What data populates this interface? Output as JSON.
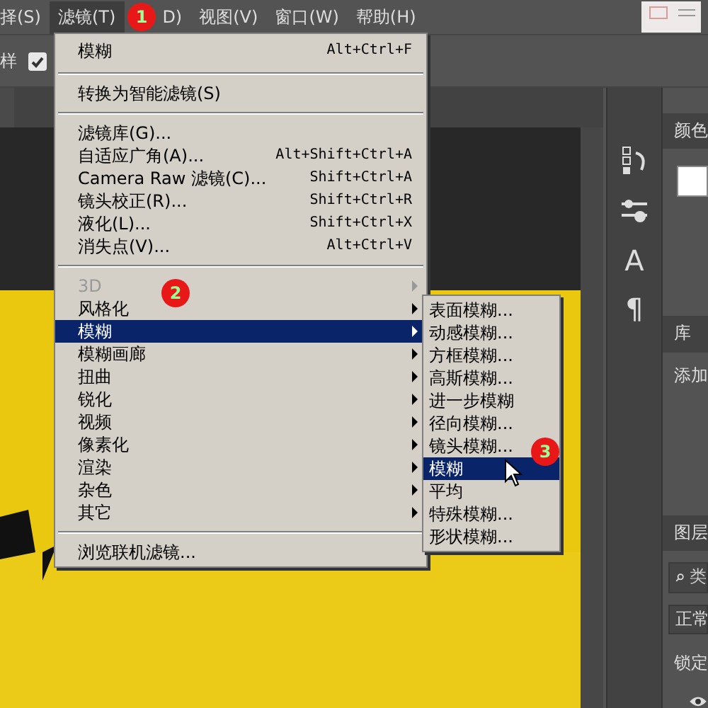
{
  "menubar": [
    {
      "label": "择(S)",
      "selected": false
    },
    {
      "label": "滤镜(T)",
      "selected": true
    },
    {
      "label": "D)",
      "selected": false
    },
    {
      "label": "视图(V)",
      "selected": false
    },
    {
      "label": "窗口(W)",
      "selected": false
    },
    {
      "label": "帮助(H)",
      "selected": false
    }
  ],
  "options_bar": {
    "label": "样",
    "checked": true
  },
  "filter_menu": [
    {
      "kind": "item",
      "label": "模糊",
      "shortcut": "Alt+Ctrl+F",
      "disabled": false,
      "selected": false
    },
    {
      "kind": "separator"
    },
    {
      "kind": "item",
      "label": "转换为智能滤镜(S)",
      "disabled": false,
      "selected": false
    },
    {
      "kind": "separator"
    },
    {
      "kind": "item",
      "label": "滤镜库(G)...",
      "disabled": false,
      "selected": false
    },
    {
      "kind": "item",
      "label": "自适应广角(A)...",
      "shortcut": "Alt+Shift+Ctrl+A",
      "disabled": false,
      "selected": false
    },
    {
      "kind": "item",
      "label": "Camera Raw 滤镜(C)...",
      "shortcut": "Shift+Ctrl+A",
      "disabled": false,
      "selected": false
    },
    {
      "kind": "item",
      "label": "镜头校正(R)...",
      "shortcut": "Shift+Ctrl+R",
      "disabled": false,
      "selected": false
    },
    {
      "kind": "item",
      "label": "液化(L)...",
      "shortcut": "Shift+Ctrl+X",
      "disabled": false,
      "selected": false
    },
    {
      "kind": "item",
      "label": "消失点(V)...",
      "shortcut": "Alt+Ctrl+V",
      "disabled": false,
      "selected": false
    },
    {
      "kind": "separator"
    },
    {
      "kind": "submenu",
      "label": "3D",
      "disabled": true,
      "selected": false
    },
    {
      "kind": "submenu",
      "label": "风格化",
      "disabled": false,
      "selected": false
    },
    {
      "kind": "submenu",
      "label": "模糊",
      "disabled": false,
      "selected": true
    },
    {
      "kind": "submenu",
      "label": "模糊画廊",
      "disabled": false,
      "selected": false
    },
    {
      "kind": "submenu",
      "label": "扭曲",
      "disabled": false,
      "selected": false
    },
    {
      "kind": "submenu",
      "label": "锐化",
      "disabled": false,
      "selected": false
    },
    {
      "kind": "submenu",
      "label": "视频",
      "disabled": false,
      "selected": false
    },
    {
      "kind": "submenu",
      "label": "像素化",
      "disabled": false,
      "selected": false
    },
    {
      "kind": "submenu",
      "label": "渲染",
      "disabled": false,
      "selected": false
    },
    {
      "kind": "submenu",
      "label": "杂色",
      "disabled": false,
      "selected": false
    },
    {
      "kind": "submenu",
      "label": "其它",
      "disabled": false,
      "selected": false
    },
    {
      "kind": "separator"
    },
    {
      "kind": "item",
      "label": "浏览联机滤镜...",
      "disabled": false,
      "selected": false
    }
  ],
  "blur_submenu": [
    {
      "label": "表面模糊...",
      "selected": false
    },
    {
      "label": "动感模糊...",
      "selected": false
    },
    {
      "label": "方框模糊...",
      "selected": false
    },
    {
      "label": "高斯模糊...",
      "selected": false
    },
    {
      "label": "进一步模糊",
      "selected": false
    },
    {
      "label": "径向模糊...",
      "selected": false
    },
    {
      "label": "镜头模糊...",
      "selected": false
    },
    {
      "label": "模糊",
      "selected": true
    },
    {
      "label": "平均",
      "selected": false
    },
    {
      "label": "特殊模糊...",
      "selected": false
    },
    {
      "label": "形状模糊...",
      "selected": false
    }
  ],
  "step_badges": [
    "1",
    "2",
    "3"
  ],
  "panel_strip": {
    "glyphs": [
      "A",
      "¶"
    ]
  },
  "right_panel": {
    "color_title": "颜色",
    "library_title": "库",
    "library_text": "添加",
    "layers_title": "图层",
    "search_placeholder": "类",
    "blend_mode": "正常",
    "lock_label": "锁定"
  }
}
